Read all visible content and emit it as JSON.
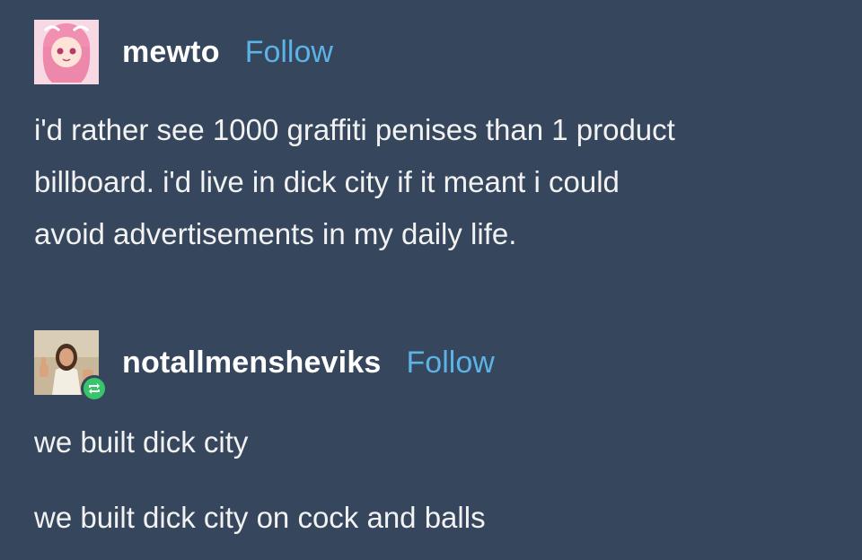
{
  "posts": [
    {
      "username": "mewto",
      "follow_label": "Follow",
      "avatar_icon": "anime-girl-avatar-icon",
      "lines": [
        "i'd rather see 1000 graffiti penises than 1 product",
        "billboard. i'd live in dick city if it meant i could",
        "avoid advertisements in my daily life."
      ]
    },
    {
      "username": "notallmensheviks",
      "follow_label": "Follow",
      "avatar_icon": "jesus-thumbs-up-avatar-icon",
      "reblog_icon": "reblog-icon",
      "paragraphs": [
        "we built dick city",
        "we built dick city on cock and balls"
      ]
    }
  ],
  "colors": {
    "background": "#36465d",
    "follow_link": "#5bb3e6",
    "reblog_badge": "#37c56c"
  }
}
